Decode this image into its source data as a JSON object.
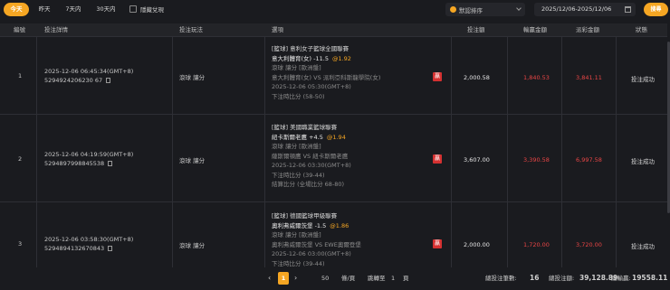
{
  "filters": {
    "tabs": [
      "今天",
      "昨天",
      "7天内",
      "30天内"
    ],
    "active_tab": 0,
    "checkbox_label": "隱藏兌現",
    "sort_label": "默認排序",
    "date_range": "2025/12/06-2025/12/06",
    "search_label": "搜尋"
  },
  "table": {
    "headers": [
      "編號",
      "投注詳情",
      "投注玩法",
      "選項",
      "投注額",
      "輸贏金額",
      "派彩金額",
      "狀態"
    ],
    "rows": [
      {
        "index": "1",
        "time": "2025-12-06 06:45:34(GMT+8)",
        "order_id": "5294924206230 67",
        "play": "滾球 讓分",
        "league": "[籃球] 意利女子籃球全國聯賽",
        "pick": "意大利體育(女) -11.5",
        "odds": "@1.92",
        "details": [
          "滾球 讓分 [歐洲盤]",
          "意大利體育(女) VS 派利亞科斯龍學院(女)",
          "2025-12-06 05:30(GMT+8)",
          "下注時比分 (58-50)"
        ],
        "tag": "贏",
        "bet": "2,000.58",
        "win": "1,840.53",
        "payout": "3,841.11",
        "status": "投注成功"
      },
      {
        "index": "2",
        "time": "2025-12-06 04:19:59(GMT+8)",
        "order_id": "5294897998845538",
        "play": "滾球 讓分",
        "league": "[籃球] 美國職業籃球聯賽",
        "pick": "紐卡斯爾老鷹 +4.5",
        "odds": "@1.94",
        "details": [
          "滾球 讓分 [歐洲盤]",
          "薩斯爾頓鷹 VS 紐卡斯爾老鷹",
          "2025-12-06 03:30(GMT+8)",
          "下注時比分 (39-44)",
          "結算比分 (全場比分 68-80)"
        ],
        "tag": "贏",
        "bet": "3,607.00",
        "win": "3,390.58",
        "payout": "6,997.58",
        "status": "投注成功"
      },
      {
        "index": "3",
        "time": "2025-12-06 03:58:30(GMT+8)",
        "order_id": "5294894132670843",
        "play": "滾球 讓分",
        "league": "[籃球] 德國籃球甲級聯賽",
        "pick": "奧利弗威爾茨堡 -1.5",
        "odds": "@1.86",
        "details": [
          "滾球 讓分 [歐洲盤]",
          "奧利弗威爾茨堡 VS EWE奧爾登堡",
          "2025-12-06 03:00(GMT+8)",
          "下注時比分 (39-44)"
        ],
        "tag": "贏",
        "bet": "2,000.00",
        "win": "1,720.00",
        "payout": "3,720.00",
        "status": "投注成功"
      }
    ]
  },
  "pagination": {
    "current_page": "1",
    "page_size": "50",
    "page_size_unit": "條/頁",
    "goto_label": "跳轉至",
    "goto_value": "1",
    "goto_unit": "頁"
  },
  "summary": {
    "count_label": "總投注筆數:",
    "count": "16",
    "total_label": "總投注額:",
    "total": "39,128.89",
    "win_label": "總輸贏:",
    "win": "19558.11"
  },
  "colors": {
    "accent": "#f5a623",
    "loss": "#e84545",
    "background": "#1a1b1f"
  }
}
